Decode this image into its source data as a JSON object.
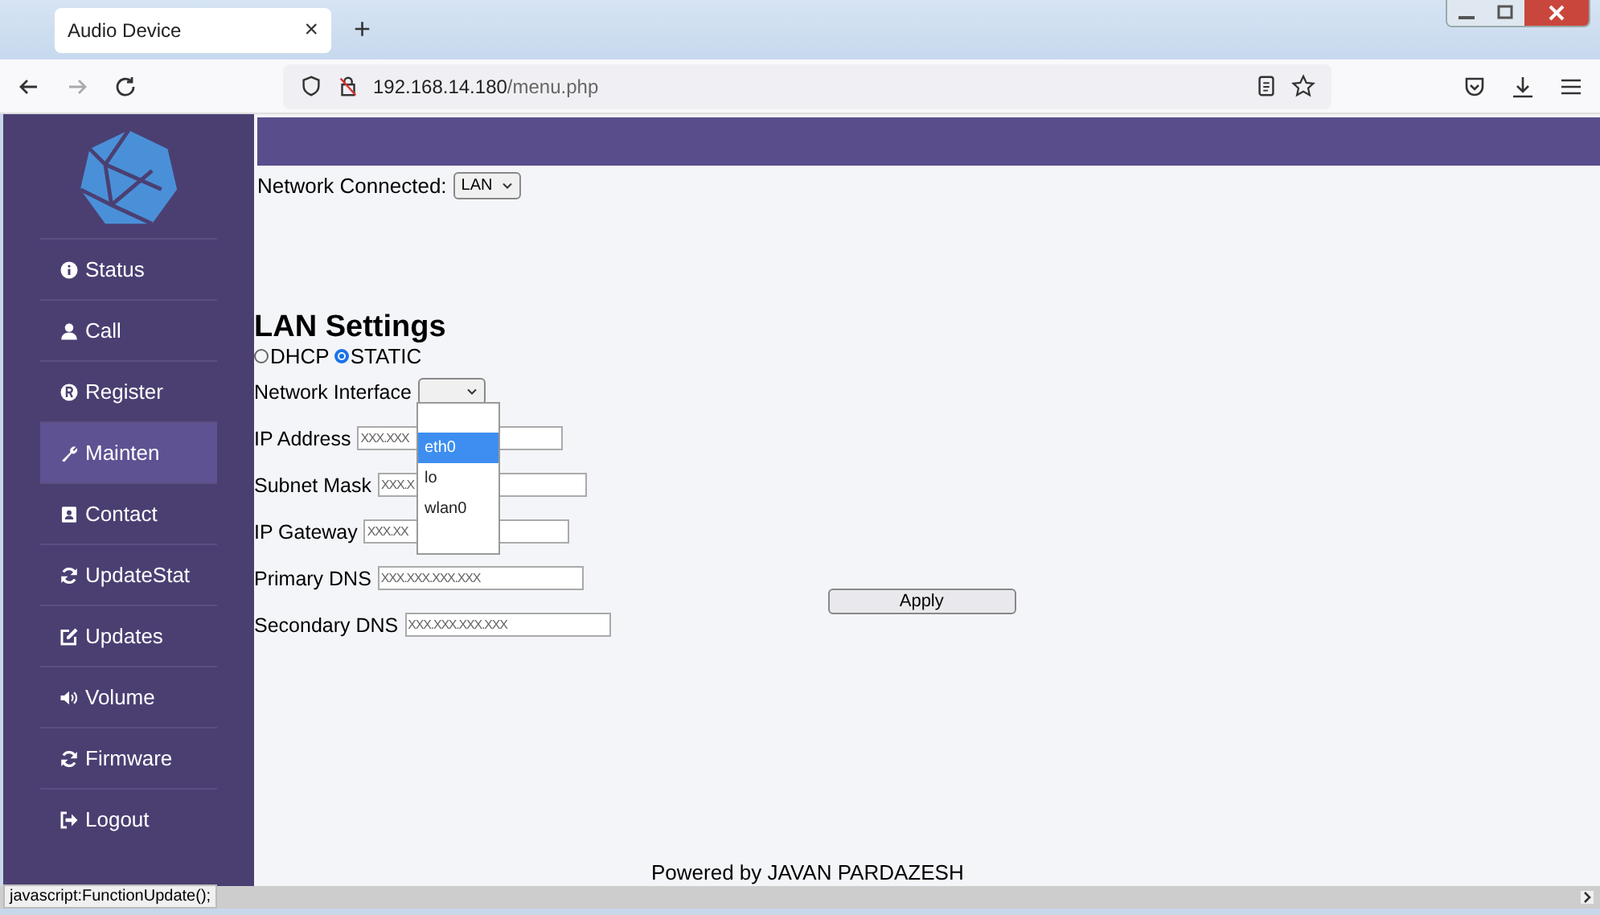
{
  "browser": {
    "tab_title": "Audio Device",
    "tab_close": "×",
    "new_tab": "+",
    "url_host": "192.168.14.180",
    "url_path": "/menu.php"
  },
  "sidebar": {
    "items": [
      {
        "label": "Status",
        "selected": false
      },
      {
        "label": "Call",
        "selected": false
      },
      {
        "label": "Register",
        "selected": false
      },
      {
        "label": "Mainten",
        "selected": true
      },
      {
        "label": "Contact",
        "selected": false
      },
      {
        "label": "UpdateStat",
        "selected": false
      },
      {
        "label": "Updates",
        "selected": false
      },
      {
        "label": "Volume",
        "selected": false
      },
      {
        "label": "Firmware",
        "selected": false
      },
      {
        "label": "Logout",
        "selected": false
      }
    ]
  },
  "network_connected": {
    "label": "Network Connected:",
    "value": "LAN"
  },
  "lan_settings": {
    "title": "LAN Settings",
    "modes": [
      {
        "label": "DHCP",
        "selected": false
      },
      {
        "label": "STATIC",
        "selected": true
      }
    ],
    "interface": {
      "label": "Network Interface",
      "options": [
        {
          "label": "eth0",
          "selected": true
        },
        {
          "label": "lo",
          "selected": false
        },
        {
          "label": "wlan0",
          "selected": false
        }
      ]
    },
    "fields": [
      {
        "label": "IP Address",
        "placeholder": "XXX.XXX"
      },
      {
        "label": "Subnet Mask",
        "placeholder": "XXX.X"
      },
      {
        "label": "IP Gateway",
        "placeholder": "XXX.XX"
      },
      {
        "label": "Primary DNS",
        "placeholder": "XXX.XXX.XXX.XXX"
      },
      {
        "label": "Secondary DNS",
        "placeholder": "XXX.XXX.XXX.XXX"
      }
    ],
    "apply": "Apply"
  },
  "footer": "Powered by JAVAN PARDAZESH",
  "status_bar": "javascript:FunctionUpdate();"
}
